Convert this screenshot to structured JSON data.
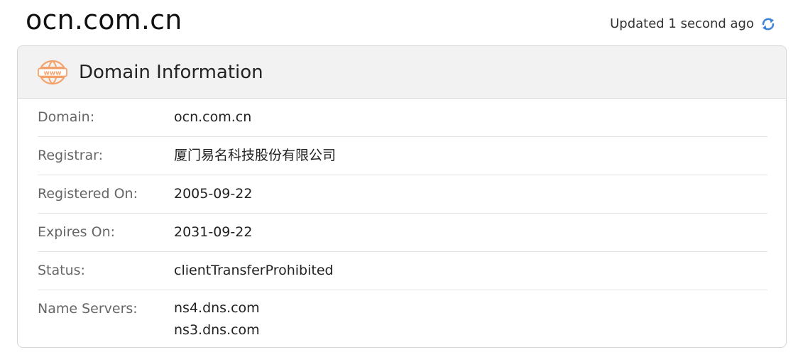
{
  "header": {
    "domain": "ocn.com.cn",
    "updated": "Updated 1 second ago"
  },
  "card": {
    "title": "Domain Information",
    "icon_text": "www",
    "rows": [
      {
        "label": "Domain:",
        "value": "ocn.com.cn"
      },
      {
        "label": "Registrar:",
        "value": "厦门易名科技股份有限公司"
      },
      {
        "label": "Registered On:",
        "value": "2005-09-22"
      },
      {
        "label": "Expires On:",
        "value": "2031-09-22"
      },
      {
        "label": "Status:",
        "value": "clientTransferProhibited"
      },
      {
        "label": "Name Servers:",
        "values": [
          "ns4.dns.com",
          "ns3.dns.com"
        ]
      }
    ]
  },
  "colors": {
    "accent_orange": "#f5a26a",
    "refresh_blue": "#3b82d6"
  }
}
